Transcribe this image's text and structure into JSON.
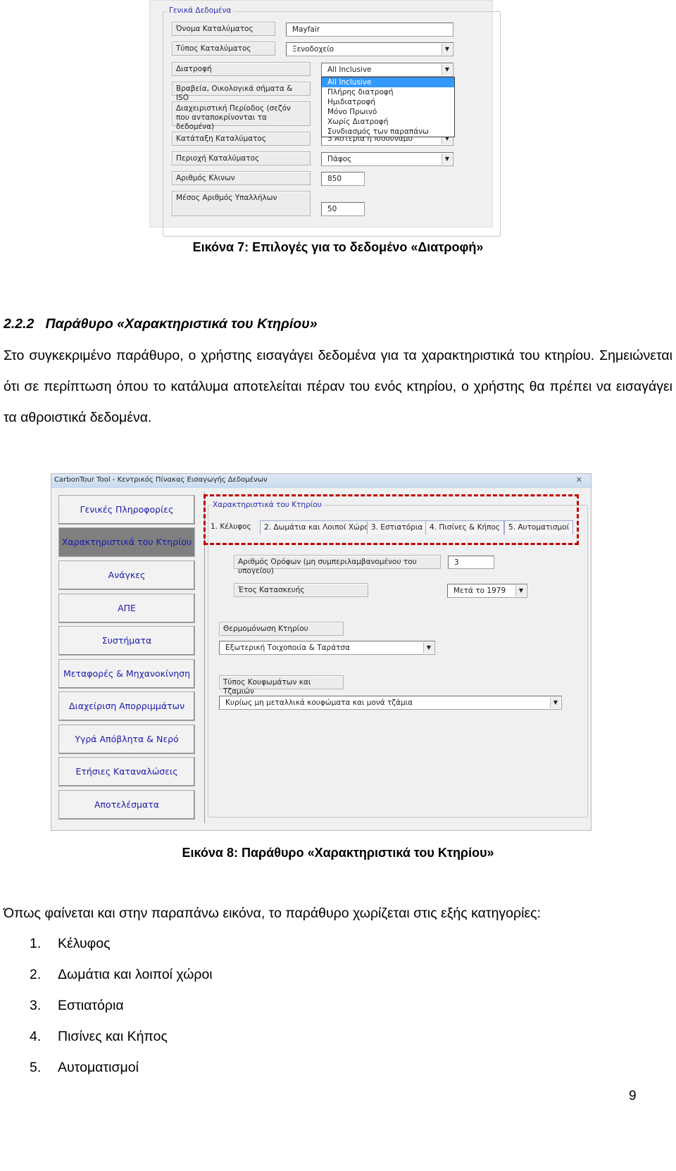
{
  "figure7": {
    "group_title": "Γενικά Δεδομένα",
    "fields": [
      {
        "label": "Όνομα Καταλύματος",
        "value": "Mayfair",
        "type": "text"
      },
      {
        "label": "Τύπος Καταλύματος",
        "value": "Ξενοδοχείο",
        "type": "combo"
      },
      {
        "label": "Διατροφή",
        "value": "All Inclusive",
        "type": "combo"
      },
      {
        "label": "Βραβεία, Οικολογικά σήματα & ISO"
      },
      {
        "label": "Διαχειριστική Περίοδος (σεζόν που ανταποκρίνονται τα δεδομένα)"
      },
      {
        "label": "Κατάταξη Καταλύματος",
        "value": "3 Αστέρια ή Ισοδύναμο",
        "type": "combo"
      },
      {
        "label": "Περιοχή Καταλύματος",
        "value": "Πάφος",
        "type": "combo"
      },
      {
        "label": "Αριθμός Κλινων",
        "value": "850",
        "type": "text"
      },
      {
        "label": "Μέσος Αριθμός Υπαλλήλων",
        "value": "50",
        "type": "text"
      }
    ],
    "dropdown_options": [
      "All Inclusive",
      "Πλήρης διατροφή",
      "Ημιδιατροφή",
      "Μόνο Πρωινό",
      "Χωρίς Διατροφή",
      "Συνδιασμός των παραπάνω"
    ],
    "dropdown_selected": "All Inclusive",
    "caption": "Εικόνα 7: Επιλογές για το δεδομένο «Διατροφή»"
  },
  "section_heading": "2.2.2   Παράθυρο «Χαρακτηριστικά του Κτηρίου»",
  "paragraph1": "Στο συγκεκριμένο παράθυρο, ο χρήστης εισαγάγει δεδομένα για τα χαρακτηριστικά του κτηρίου. Σημειώνεται ότι σε περίπτωση όπου το κατάλυμα αποτελείται πέραν του ενός κτηρίου, ο χρήστης θα πρέπει να εισαγάγει τα αθροιστικά δεδομένα.",
  "figure8": {
    "window_title": "CarbonTour Tool - Κεντρικός Πίνακας Εισαγωγής Δεδομένων",
    "close_label": "✕",
    "sidebar": [
      "Γενικές Πληροφορίες",
      "Χαρακτηριστικά του Κτηρίου",
      "Ανάγκες",
      "ΑΠΕ",
      "Συστήματα",
      "Μεταφορές & Μηχανοκίνηση",
      "Διαχείριση Απορριμμάτων",
      "Υγρά Απόβλητα & Νερό",
      "Ετήσιες Καταναλώσεις",
      "Αποτελέσματα"
    ],
    "sidebar_active": "Χαρακτηριστικά του Κτηρίου",
    "group_title": "Χαρακτηριστικά του Κτηρίου",
    "tabs": [
      "1.  Κέλυφος",
      "2.  Δωμάτια και Λοιποί Χώροι",
      "3.  Εστιατόρια",
      "4.  Πισίνες & Κήπος",
      "5.  Αυτοματισμοί"
    ],
    "active_tab": "1.  Κέλυφος",
    "floors_label": "Αριθμός Ορόφων (μη συμπεριλαμβανομένου του υπογείου)",
    "floors_value": "3",
    "year_label": "Έτος Κατασκευής",
    "year_value": "Μετά το 1979",
    "insulation_label": "Θερμομόνωση Κτηρίου",
    "insulation_value": "Εξωτερική Τοιχοποιία & Ταράτσα",
    "frames_label": "Τύπος Κουφωμάτων και Τζαμιών",
    "frames_value": "Κυρίως μη μεταλλικά κουφώματα και μονά τζάμια",
    "highlight_color": "#c00000",
    "caption": "Εικόνα 8: Παράθυρο «Χαρακτηριστικά του Κτηρίου»"
  },
  "paragraph2": "Όπως φαίνεται και στην παραπάνω εικόνα, το παράθυρο χωρίζεται στις εξής κατηγορίες:",
  "list": [
    "Κέλυφος",
    "Δωμάτια και λοιποί χώροι",
    "Εστιατόρια",
    "Πισίνες και Κήπος",
    "Αυτοματισμοί"
  ],
  "page_number": "9"
}
